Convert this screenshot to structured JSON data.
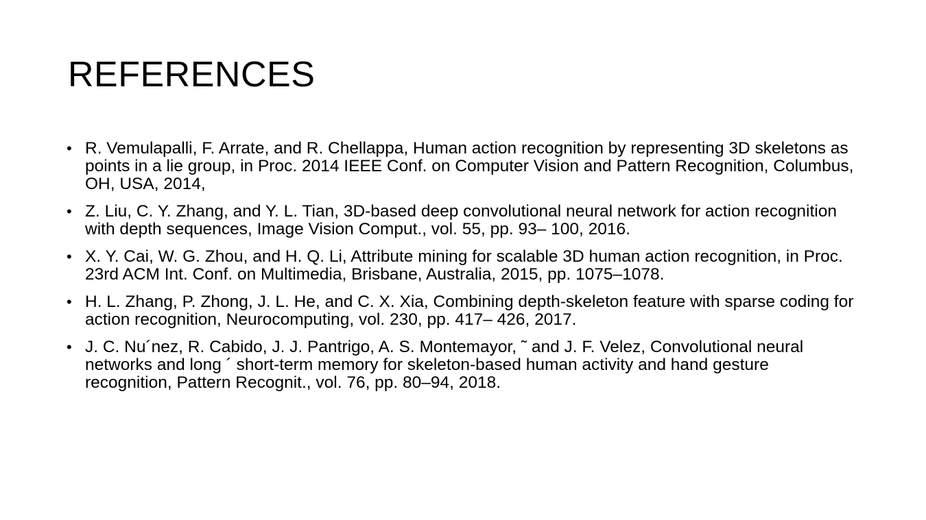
{
  "slide": {
    "title": "REFERENCES",
    "bullet_glyph": "•",
    "references": [
      "R. Vemulapalli, F. Arrate, and R. Chellappa, Human action recognition by representing 3D skeletons as points in a lie group, in Proc. 2014 IEEE Conf. on Computer Vision and Pattern Recognition, Columbus, OH, USA, 2014,",
      "Z. Liu, C. Y. Zhang, and Y. L. Tian, 3D-based deep convolutional neural network for action recognition with depth sequences, Image Vision Comput., vol. 55, pp. 93– 100, 2016.",
      " X. Y. Cai, W. G. Zhou, and H. Q. Li, Attribute mining for scalable 3D human action recognition, in Proc. 23rd ACM Int. Conf. on Multimedia, Brisbane, Australia, 2015, pp. 1075–1078.",
      " H. L. Zhang, P. Zhong, J. L. He, and C. X. Xia, Combining depth-skeleton feature with sparse coding for action recognition, Neurocomputing, vol. 230, pp. 417– 426, 2017.",
      " J. C. Nu´nez, R. Cabido, J. J. Pantrigo, A. S. Montemayor, ˜ and J. F. Velez, Convolutional neural networks and long ´ short-term memory for skeleton-based human activity and hand gesture recognition, Pattern Recognit., vol. 76, pp. 80–94, 2018."
    ]
  },
  "colors": {
    "background": "#ffffff",
    "text": "#000000"
  }
}
